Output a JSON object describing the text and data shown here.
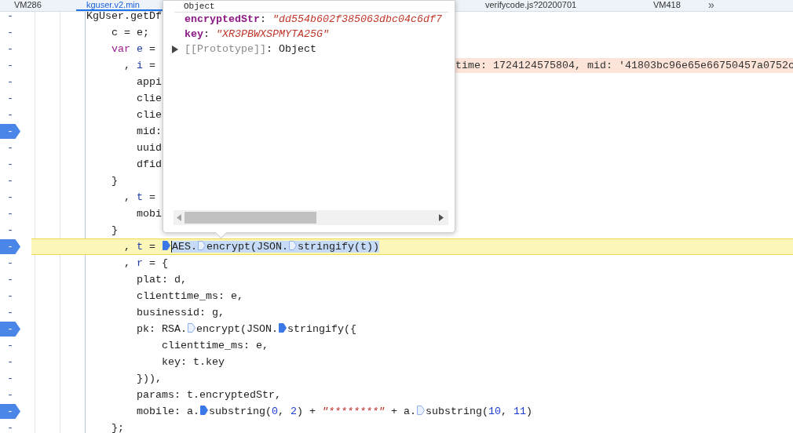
{
  "tabs": [
    {
      "label": "VM286",
      "selected": false
    },
    {
      "label": "kguser.v2.min",
      "selected": true
    },
    {
      "label": "verifycode.js?20200701",
      "selected": false
    },
    {
      "label": "VM418",
      "selected": false
    }
  ],
  "more_tabs": "»",
  "code_lines": [
    {
      "marker": "-",
      "breakpoint": false,
      "paused": false,
      "tokens": [
        {
          "kind": "plain",
          "text": "KgUser.getDf"
        }
      ]
    },
    {
      "marker": "-",
      "breakpoint": false,
      "paused": false,
      "tokens": [
        {
          "kind": "plain",
          "text": "    c = e;"
        }
      ]
    },
    {
      "marker": "-",
      "breakpoint": false,
      "paused": false,
      "tokens": [
        {
          "kind": "keyword",
          "text": "    var"
        },
        {
          "kind": "def",
          "text": " e"
        },
        {
          "kind": "plain",
          "text": " ="
        }
      ]
    },
    {
      "marker": "-",
      "breakpoint": false,
      "paused": false,
      "tokens": [
        {
          "kind": "plain",
          "text": "      , "
        },
        {
          "kind": "def",
          "text": "i"
        },
        {
          "kind": "plain",
          "text": " ="
        }
      ],
      "inline_value": "time: 1724124575804, mid: '41803bc96e65e66750457a0752c"
    },
    {
      "marker": "-",
      "breakpoint": false,
      "paused": false,
      "tokens": [
        {
          "kind": "plain",
          "text": "        appi"
        }
      ]
    },
    {
      "marker": "-",
      "breakpoint": false,
      "paused": false,
      "tokens": [
        {
          "kind": "plain",
          "text": "        clie"
        }
      ]
    },
    {
      "marker": "-",
      "breakpoint": false,
      "paused": false,
      "tokens": [
        {
          "kind": "plain",
          "text": "        clie"
        }
      ]
    },
    {
      "marker": "-",
      "breakpoint": true,
      "paused": false,
      "tokens": [
        {
          "kind": "plain",
          "text": "        mid:"
        }
      ]
    },
    {
      "marker": "-",
      "breakpoint": false,
      "paused": false,
      "tokens": [
        {
          "kind": "plain",
          "text": "        uuid"
        }
      ]
    },
    {
      "marker": "-",
      "breakpoint": false,
      "paused": false,
      "tokens": [
        {
          "kind": "plain",
          "text": "        dfid"
        }
      ]
    },
    {
      "marker": "-",
      "breakpoint": false,
      "paused": false,
      "tokens": [
        {
          "kind": "plain",
          "text": "    }"
        }
      ]
    },
    {
      "marker": "-",
      "breakpoint": false,
      "paused": false,
      "tokens": [
        {
          "kind": "plain",
          "text": "      , "
        },
        {
          "kind": "def",
          "text": "t"
        },
        {
          "kind": "plain",
          "text": " ="
        }
      ]
    },
    {
      "marker": "-",
      "breakpoint": false,
      "paused": false,
      "tokens": [
        {
          "kind": "plain",
          "text": "        mobi"
        }
      ]
    },
    {
      "marker": "-",
      "breakpoint": false,
      "paused": false,
      "tokens": [
        {
          "kind": "plain",
          "text": "    }"
        }
      ]
    },
    {
      "marker": "-",
      "breakpoint": true,
      "paused": true,
      "tokens": [
        {
          "kind": "plain",
          "text": "      , "
        },
        {
          "kind": "def",
          "text": "t"
        },
        {
          "kind": "plain",
          "text": " = "
        },
        {
          "kind": "step",
          "active": true
        }
      ],
      "selection": [
        {
          "kind": "plain",
          "text": "AES."
        },
        {
          "kind": "step",
          "active": false
        },
        {
          "kind": "plain",
          "text": "encrypt(JSON."
        },
        {
          "kind": "step",
          "active": false
        },
        {
          "kind": "plain",
          "text": "stringify(t))"
        }
      ]
    },
    {
      "marker": "-",
      "breakpoint": false,
      "paused": false,
      "tokens": [
        {
          "kind": "plain",
          "text": "      , "
        },
        {
          "kind": "def",
          "text": "r"
        },
        {
          "kind": "plain",
          "text": " = {"
        }
      ]
    },
    {
      "marker": "-",
      "breakpoint": false,
      "paused": false,
      "tokens": [
        {
          "kind": "plain",
          "text": "        plat: d,"
        }
      ]
    },
    {
      "marker": "-",
      "breakpoint": false,
      "paused": false,
      "tokens": [
        {
          "kind": "plain",
          "text": "        clienttime_ms: e,"
        }
      ]
    },
    {
      "marker": "-",
      "breakpoint": false,
      "paused": false,
      "tokens": [
        {
          "kind": "plain",
          "text": "        businessid: g,"
        }
      ]
    },
    {
      "marker": "-",
      "breakpoint": true,
      "paused": false,
      "tokens": [
        {
          "kind": "plain",
          "text": "        pk: RSA."
        },
        {
          "kind": "step",
          "active": false
        },
        {
          "kind": "plain",
          "text": "encrypt(JSON."
        },
        {
          "kind": "step",
          "active": true
        },
        {
          "kind": "plain",
          "text": "stringify({"
        }
      ]
    },
    {
      "marker": "-",
      "breakpoint": false,
      "paused": false,
      "tokens": [
        {
          "kind": "plain",
          "text": "            clienttime_ms: e,"
        }
      ]
    },
    {
      "marker": "-",
      "breakpoint": false,
      "paused": false,
      "tokens": [
        {
          "kind": "plain",
          "text": "            key: t.key"
        }
      ]
    },
    {
      "marker": "-",
      "breakpoint": false,
      "paused": false,
      "tokens": [
        {
          "kind": "plain",
          "text": "        })),"
        }
      ]
    },
    {
      "marker": "-",
      "breakpoint": false,
      "paused": false,
      "tokens": [
        {
          "kind": "plain",
          "text": "        params: t.encryptedStr,"
        }
      ]
    },
    {
      "marker": "-",
      "breakpoint": true,
      "paused": false,
      "tokens": [
        {
          "kind": "plain",
          "text": "        mobile: a."
        },
        {
          "kind": "step",
          "active": true
        },
        {
          "kind": "plain",
          "text": "substring("
        },
        {
          "kind": "number",
          "text": "0"
        },
        {
          "kind": "plain",
          "text": ", "
        },
        {
          "kind": "number",
          "text": "2"
        },
        {
          "kind": "plain",
          "text": ") + "
        },
        {
          "kind": "string",
          "text": "\"********\""
        },
        {
          "kind": "plain",
          "text": " + a."
        },
        {
          "kind": "step",
          "active": false
        },
        {
          "kind": "plain",
          "text": "substring("
        },
        {
          "kind": "number",
          "text": "10"
        },
        {
          "kind": "plain",
          "text": ", "
        },
        {
          "kind": "number",
          "text": "11"
        },
        {
          "kind": "plain",
          "text": ")"
        }
      ]
    },
    {
      "marker": "-",
      "breakpoint": false,
      "paused": false,
      "tokens": [
        {
          "kind": "plain",
          "text": "    };"
        }
      ]
    }
  ],
  "popover": {
    "title": "Object",
    "properties": [
      {
        "kind": "value",
        "key": "encryptedStr",
        "separator": ":",
        "value": "\"dd554b602f385063dbc04c6df7"
      },
      {
        "kind": "value",
        "key": "key",
        "separator": ":",
        "value": "\"XR3PBWXSPMYTA25G\""
      },
      {
        "kind": "expandable",
        "key": "[[Prototype]]",
        "separator": ":",
        "value": "Object",
        "expanded": false
      }
    ]
  }
}
